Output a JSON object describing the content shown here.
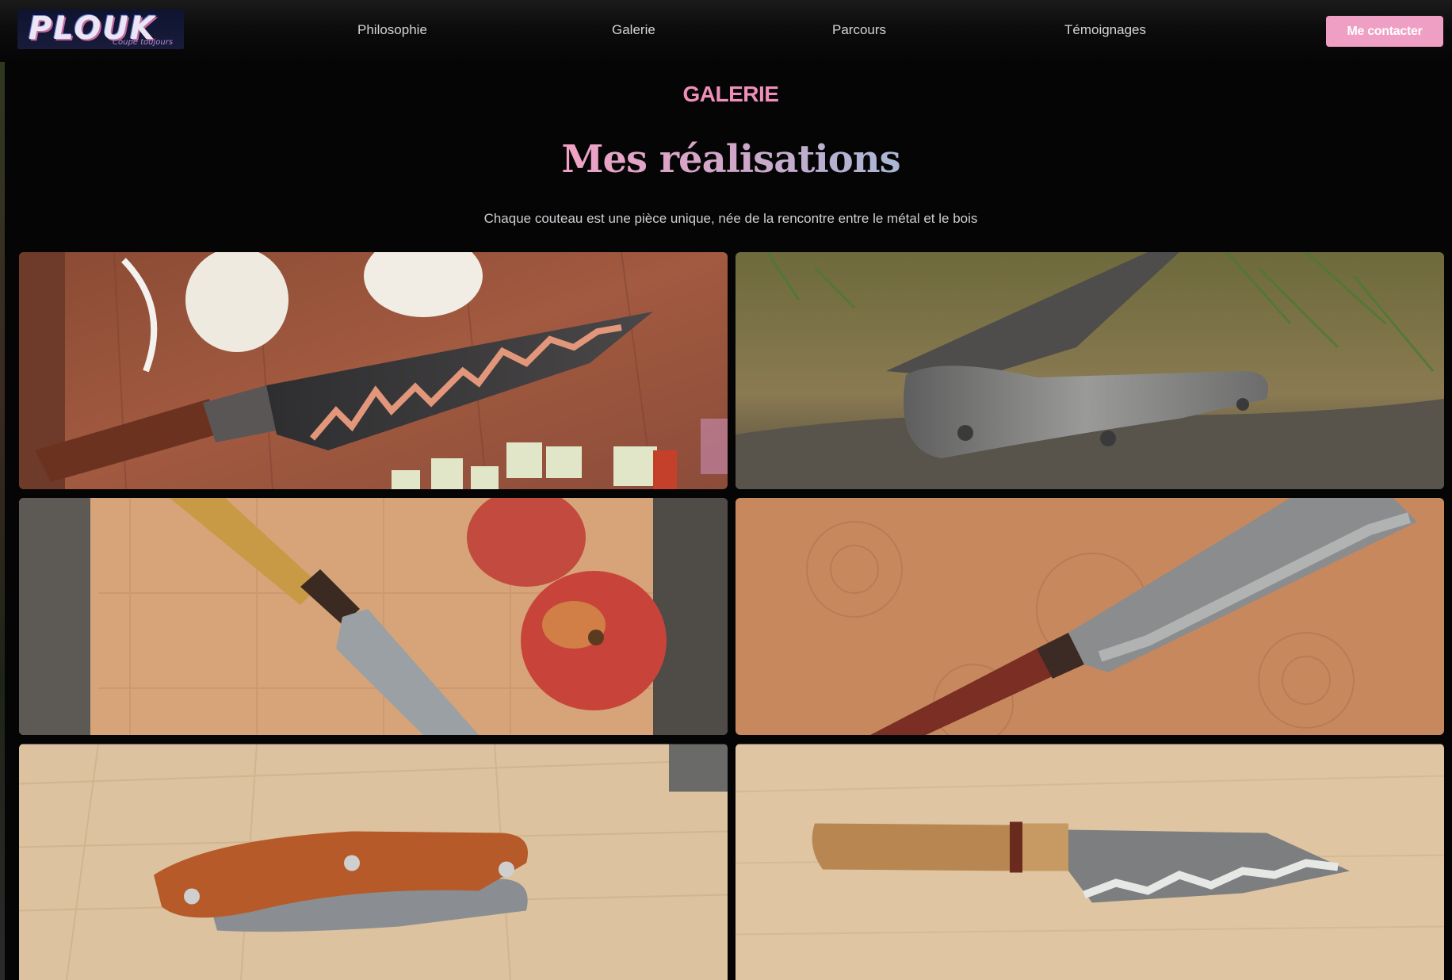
{
  "brand": {
    "name": "PLOUK",
    "tagline": "Coupe toujours"
  },
  "nav": {
    "items": [
      {
        "label": "Philosophie"
      },
      {
        "label": "Galerie"
      },
      {
        "label": "Parcours"
      },
      {
        "label": "Témoignages"
      }
    ],
    "cta_label": "Me contacter"
  },
  "gallery": {
    "eyebrow": "GALERIE",
    "title": "Mes réalisations",
    "subtitle": "Chaque couteau est une pièce unique, née de la rencontre entre le métal et le bois",
    "photos": [
      {
        "subject": "santoku knife with copper wave pattern on cutting board with onions and zucchini"
      },
      {
        "subject": "folding knife with grey wood handle on log in grass"
      },
      {
        "subject": "paring knife with light wood handle next to red apples"
      },
      {
        "subject": "kitchen knife with hammered blade and red wood handle on end-grain board"
      },
      {
        "subject": "folding knife with olive wood handle on wooden board"
      },
      {
        "subject": "santoku knife with oak handle on light wood"
      }
    ]
  },
  "colors": {
    "accent": "#ef9fc3",
    "eyebrow": "#ef8fb8",
    "background": "#050506"
  }
}
